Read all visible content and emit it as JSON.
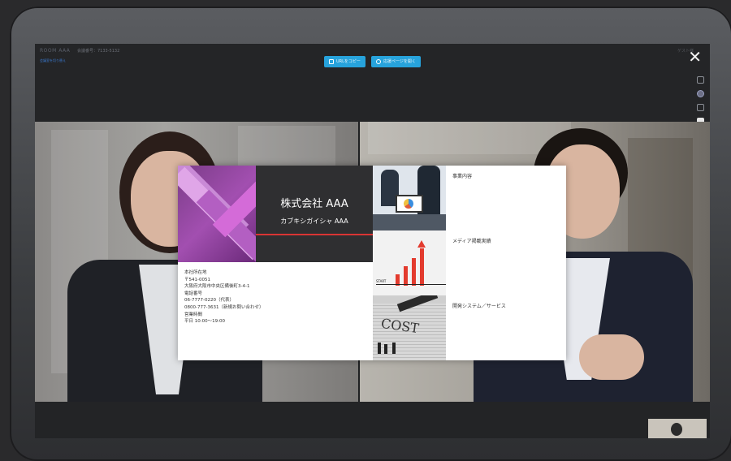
{
  "app": {
    "logo": "ROOM AAA",
    "meeting_id": "会議番号：7133-5132",
    "sub_link": "会議室を切り替え",
    "user_label": "ゲスト様",
    "close_icon": "close-icon"
  },
  "toolbar": {
    "copy_url_label": "URLをコピー",
    "open_page_label": "応援ページを開く"
  },
  "side_icons": [
    "chat-icon",
    "participant-icon",
    "comment-icon",
    "document-icon"
  ],
  "card": {
    "company_name": "株式会社 AAA",
    "company_kana": "カブキシガイシャ AAA",
    "info": {
      "hq_label": "本社所在地",
      "postal": "〒541-0051",
      "address": "大阪府大阪市中央区備後町3-4-1",
      "phone_label": "電話番号",
      "phone_main": "06-7777-0220（代表）",
      "phone_new": "0800-777-3631（新規お問い合わせ）",
      "hours_label": "営業時間",
      "hours": "平日 10:00～19:00"
    },
    "sections": [
      "事業内容",
      "メディア掲載実績",
      "開発システム／サービス"
    ],
    "photo_labels": {
      "start": "START",
      "cost": "COST"
    }
  },
  "colors": {
    "accent_button": "#27a3dc",
    "company_rule": "#d93434",
    "logo_purple": "#8e44a0"
  }
}
